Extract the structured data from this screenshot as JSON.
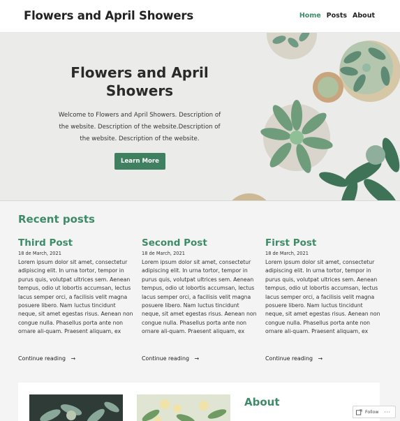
{
  "header": {
    "site_title": "Flowers and April Showers",
    "nav": [
      {
        "label": "Home",
        "active": true
      },
      {
        "label": "Posts",
        "active": false
      },
      {
        "label": "About",
        "active": false
      }
    ]
  },
  "hero": {
    "title": "Flowers and April Showers",
    "description": "Welcome to Flowers and April Showers. Description of the website. Description of the website.Description of the website. Description of the website.",
    "button_label": "Learn More"
  },
  "recent": {
    "heading": "Recent posts",
    "posts": [
      {
        "title": "Third Post",
        "date": "18 de March, 2021",
        "body": "Lorem ipsum dolor sit amet, consectetur adipiscing elit. In urna tortor, tempor in purus quis, volutpat ultrices sem. Aenean tempus, odio ut lobortis accumsan, lectus lacus semper orci, a facilisis velit magna posuere libero. Nam luctus tincidunt neque, sit amet egestas risus. Aenean non congue nulla. Phasellus porta ante non ornare ali-quam. Praesent aliquam, ex",
        "more": "Continue reading"
      },
      {
        "title": "Second Post",
        "date": "18 de March, 2021",
        "body": "Lorem ipsum dolor sit amet, consectetur adipiscing elit. In urna tortor, tempor in purus quis, volutpat ultrices sem. Aenean tempus, odio ut lobortis accumsan, lectus lacus semper orci, a facilisis velit magna posuere libero. Nam luctus tincidunt neque, sit amet egestas risus. Aenean non congue nulla. Phasellus porta ante non ornare ali-quam. Praesent aliquam, ex",
        "more": "Continue reading"
      },
      {
        "title": "First Post",
        "date": "18 de March, 2021",
        "body": "Lorem ipsum dolor sit amet, consectetur adipiscing elit. In urna tortor, tempor in purus quis, volutpat ultrices sem. Aenean tempus, odio ut lobortis accumsan, lectus lacus semper orci, a facilisis velit magna posuere libero. Nam luctus tincidunt neque, sit amet egestas risus. Aenean non congue nulla. Phasellus porta ante non ornare ali-quam. Praesent aliquam, ex",
        "more": "Continue reading"
      }
    ],
    "arrow_icon": "→"
  },
  "about": {
    "heading": "About"
  },
  "follow": {
    "label": "Follow",
    "more": "···"
  },
  "colors": {
    "accent": "#3e8b68",
    "button": "#3e8060"
  }
}
